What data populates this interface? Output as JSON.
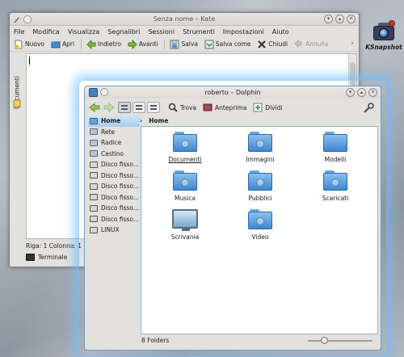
{
  "ksnapshot": {
    "label": "KSnapshot"
  },
  "kate": {
    "title": "Senza nome – Kate",
    "menu": [
      "File",
      "Modifica",
      "Visualizza",
      "Segnalibri",
      "Sessioni",
      "Strumenti",
      "Impostazioni",
      "Aiuto"
    ],
    "toolbar": {
      "new": "Nuovo",
      "open": "Apri",
      "back": "Indietro",
      "forward": "Avanti",
      "save": "Salva",
      "save_as": "Salva come",
      "close": "Chiudi",
      "undo": "Annulla"
    },
    "side_tab": "Documenti",
    "status": "Riga: 1 Colonna: 1",
    "terminal": "Terminale"
  },
  "dolphin": {
    "title": "roberto – Dolphin",
    "toolbar": {
      "find": "Trova",
      "preview": "Anteprima",
      "split": "Dividi"
    },
    "places": [
      "Home",
      "Rete",
      "Radice",
      "Cestino",
      "Disco fisso...",
      "Disco fisso...",
      "Disco fisso...",
      "Disco fisso...",
      "Disco fisso...",
      "Disco fisso...",
      "LINUX"
    ],
    "breadcrumb": "Home",
    "files": [
      "Documenti",
      "Immagini",
      "Modelli",
      "Musica",
      "Pubblici",
      "Scaricati",
      "Scrivania",
      "Video"
    ],
    "status": "8 Folders"
  },
  "colors": {
    "folder_blue": "#3f86cf",
    "selection": "#a8ccee",
    "glow": "#6ebeff"
  }
}
